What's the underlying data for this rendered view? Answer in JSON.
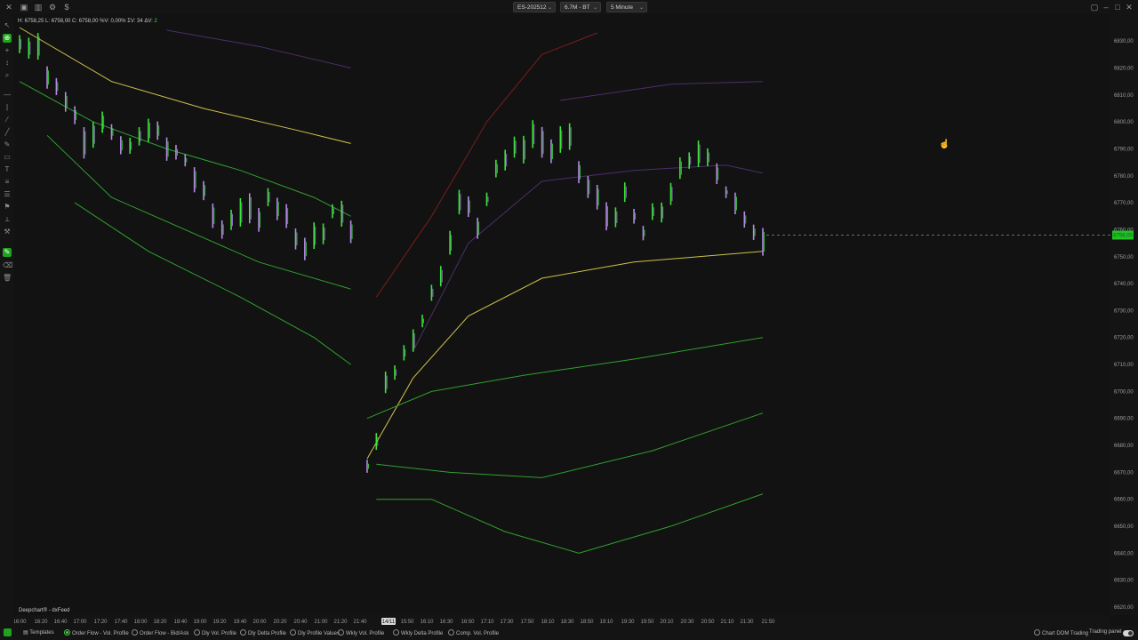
{
  "toolbar": {
    "symbol": "ES-202512",
    "bar_type": "6.7M - BT",
    "timeframe": "5 Minute"
  },
  "info_line": {
    "text": "H: 6758,25  L: 6758,00  C: 6758,00  %V: 0,00%  ΣV: 34  ΔV:",
    "delta": "2"
  },
  "watermark": "Deepchart® - dxFeed",
  "bottom": {
    "templates": "Templates",
    "options": [
      {
        "label": "Order Flow - Vol. Profile",
        "selected": true
      },
      {
        "label": "Order Flow - Bid/Ask",
        "selected": false
      },
      {
        "label": "Dly Vol. Profile",
        "selected": false
      },
      {
        "label": "Dly Delta Profile",
        "selected": false
      },
      {
        "label": "Dly Profile Values",
        "selected": false
      },
      {
        "label": "Wkly Vol. Profile",
        "selected": false
      },
      {
        "label": "Wkly Delta Profile",
        "selected": false
      },
      {
        "label": "Comp. Vol. Profile",
        "selected": false
      }
    ],
    "chart_dom": "Chart DOM Trading",
    "trading_panel": "Trading panel"
  },
  "colors": {
    "background": "#121212",
    "price_bar_up": "#39e639",
    "price_bar_down": "#b48ce6",
    "vwap_yellow": "#cfc24a",
    "band_green": "#2fa12f",
    "band_red": "#7a1d1d",
    "band_purple": "#4b2e6b",
    "last_price": "#22c222"
  },
  "chart_data": {
    "type": "line",
    "series_kind": "5-minute price bars with VWAP and deviation bands",
    "ylim": [
      6620,
      6835
    ],
    "last_price": 6758.0,
    "y_ticks": [
      "6830,00",
      "6820,00",
      "6810,00",
      "6800,00",
      "6790,00",
      "6780,00",
      "6770,00",
      "6760,00",
      "6750,00",
      "6740,00",
      "6730,00",
      "6720,00",
      "6710,00",
      "6700,00",
      "6690,00",
      "6680,00",
      "6670,00",
      "6660,00",
      "6650,00",
      "6640,00",
      "6630,00",
      "6620,00"
    ],
    "x_ticks": [
      "16:00",
      "16:20",
      "16:40",
      "17:00",
      "17:20",
      "17:40",
      "18:00",
      "18:20",
      "18:40",
      "19:00",
      "19:20",
      "19:40",
      "20:00",
      "20:20",
      "20:40",
      "21:00",
      "21:20",
      "21:40",
      "14/11",
      "15:50",
      "16:10",
      "16:30",
      "16:50",
      "17:10",
      "17:30",
      "17:50",
      "18:10",
      "18:30",
      "18:50",
      "19:10",
      "19:30",
      "19:50",
      "20:10",
      "20:30",
      "20:50",
      "21:10",
      "21:30",
      "21:50"
    ],
    "price_path": [
      {
        "slot": 0,
        "price": 6828
      },
      {
        "slot": 2,
        "price": 6830
      },
      {
        "slot": 3,
        "price": 6818
      },
      {
        "slot": 5,
        "price": 6808
      },
      {
        "slot": 7,
        "price": 6795
      },
      {
        "slot": 9,
        "price": 6802
      },
      {
        "slot": 11,
        "price": 6788
      },
      {
        "slot": 13,
        "price": 6793
      },
      {
        "slot": 14,
        "price": 6798
      },
      {
        "slot": 16,
        "price": 6790
      },
      {
        "slot": 18,
        "price": 6786
      },
      {
        "slot": 20,
        "price": 6772
      },
      {
        "slot": 22,
        "price": 6760
      },
      {
        "slot": 24,
        "price": 6768
      },
      {
        "slot": 26,
        "price": 6762
      },
      {
        "slot": 27,
        "price": 6775
      },
      {
        "slot": 29,
        "price": 6765
      },
      {
        "slot": 31,
        "price": 6755
      },
      {
        "slot": 33,
        "price": 6760
      },
      {
        "slot": 35,
        "price": 6768
      },
      {
        "slot": 36,
        "price": 6757
      },
      {
        "slot": 37,
        "price": 6670
      },
      {
        "slot": 38,
        "price": 6685
      },
      {
        "slot": 39,
        "price": 6700
      },
      {
        "slot": 41,
        "price": 6715
      },
      {
        "slot": 43,
        "price": 6728
      },
      {
        "slot": 45,
        "price": 6745
      },
      {
        "slot": 47,
        "price": 6770
      },
      {
        "slot": 49,
        "price": 6763
      },
      {
        "slot": 51,
        "price": 6785
      },
      {
        "slot": 53,
        "price": 6788
      },
      {
        "slot": 55,
        "price": 6795
      },
      {
        "slot": 57,
        "price": 6790
      },
      {
        "slot": 59,
        "price": 6792
      },
      {
        "slot": 61,
        "price": 6775
      },
      {
        "slot": 63,
        "price": 6765
      },
      {
        "slot": 65,
        "price": 6770
      },
      {
        "slot": 67,
        "price": 6758
      },
      {
        "slot": 69,
        "price": 6768
      },
      {
        "slot": 71,
        "price": 6780
      },
      {
        "slot": 73,
        "price": 6788
      },
      {
        "slot": 74,
        "price": 6790
      },
      {
        "slot": 76,
        "price": 6775
      },
      {
        "slot": 78,
        "price": 6762
      },
      {
        "slot": 80,
        "price": 6758
      }
    ],
    "lines": [
      {
        "color": "#cfc24a",
        "segment": 1,
        "points": [
          [
            0,
            6835
          ],
          [
            10,
            6815
          ],
          [
            20,
            6805
          ],
          [
            30,
            6797
          ],
          [
            36,
            6792
          ]
        ]
      },
      {
        "color": "#2fa12f",
        "segment": 1,
        "points": [
          [
            0,
            6815
          ],
          [
            8,
            6800
          ],
          [
            16,
            6790
          ],
          [
            24,
            6782
          ],
          [
            32,
            6772
          ],
          [
            36,
            6765
          ]
        ]
      },
      {
        "color": "#2fa12f",
        "segment": 1,
        "points": [
          [
            3,
            6795
          ],
          [
            10,
            6772
          ],
          [
            18,
            6760
          ],
          [
            26,
            6748
          ],
          [
            36,
            6738
          ]
        ]
      },
      {
        "color": "#2fa12f",
        "segment": 1,
        "points": [
          [
            6,
            6770
          ],
          [
            14,
            6752
          ],
          [
            24,
            6735
          ],
          [
            32,
            6720
          ],
          [
            36,
            6710
          ]
        ]
      },
      {
        "color": "#4b2e6b",
        "segment": 1,
        "points": [
          [
            16,
            6834
          ],
          [
            26,
            6828
          ],
          [
            36,
            6820
          ]
        ]
      },
      {
        "color": "#cfc24a",
        "segment": 2,
        "points": [
          [
            37,
            6675
          ],
          [
            42,
            6705
          ],
          [
            48,
            6728
          ],
          [
            56,
            6742
          ],
          [
            66,
            6748
          ],
          [
            80,
            6752
          ]
        ]
      },
      {
        "color": "#2fa12f",
        "segment": 2,
        "points": [
          [
            37,
            6690
          ],
          [
            44,
            6700
          ],
          [
            54,
            6706
          ],
          [
            66,
            6712
          ],
          [
            80,
            6720
          ]
        ]
      },
      {
        "color": "#2fa12f",
        "segment": 2,
        "points": [
          [
            38,
            6673
          ],
          [
            46,
            6670
          ],
          [
            56,
            6668
          ],
          [
            68,
            6678
          ],
          [
            80,
            6692
          ]
        ]
      },
      {
        "color": "#2fa12f",
        "segment": 2,
        "points": [
          [
            38,
            6660
          ],
          [
            44,
            6660
          ],
          [
            52,
            6648
          ],
          [
            60,
            6640
          ],
          [
            70,
            6650
          ],
          [
            80,
            6662
          ]
        ]
      },
      {
        "color": "#7a1d1d",
        "segment": 2,
        "points": [
          [
            38,
            6735
          ],
          [
            44,
            6765
          ],
          [
            50,
            6800
          ],
          [
            56,
            6825
          ],
          [
            62,
            6833
          ]
        ]
      },
      {
        "color": "#4b2e6b",
        "segment": 2,
        "points": [
          [
            42,
            6715
          ],
          [
            48,
            6755
          ],
          [
            56,
            6778
          ],
          [
            66,
            6782
          ],
          [
            76,
            6784
          ],
          [
            80,
            6781
          ]
        ]
      },
      {
        "color": "#4b2e6b",
        "segment": 2,
        "points": [
          [
            58,
            6808
          ],
          [
            70,
            6814
          ],
          [
            80,
            6815
          ]
        ]
      }
    ]
  }
}
